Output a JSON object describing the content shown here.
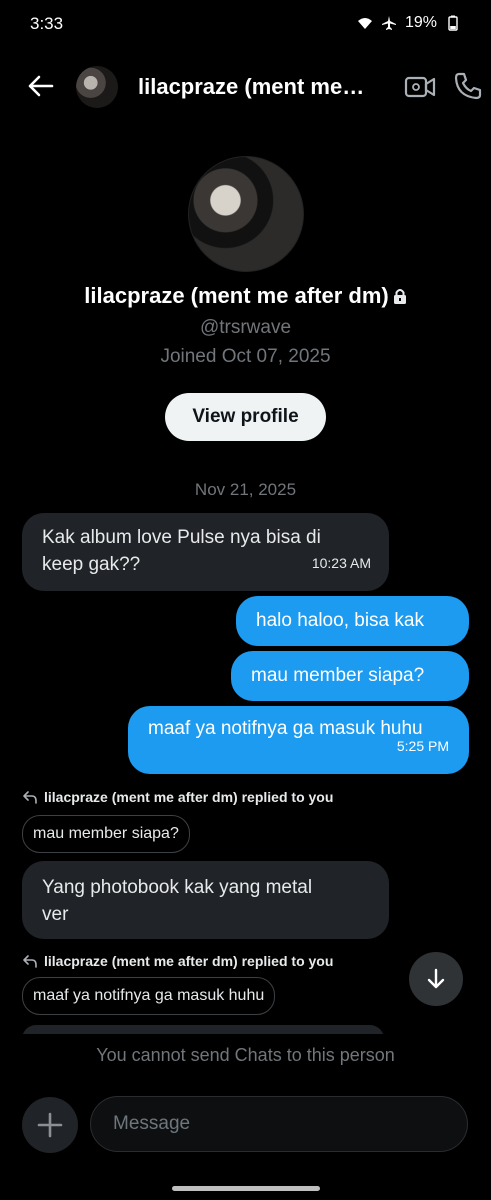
{
  "status_bar": {
    "time": "3:33",
    "battery": "19%"
  },
  "header": {
    "title": "lilacpraze (ment me…"
  },
  "profile": {
    "name": "lilacpraze (ment me after dm)",
    "handle": "@trsrwave",
    "joined": "Joined Oct 07, 2025",
    "view_profile_label": "View profile"
  },
  "conversation": {
    "date": "Nov 21, 2025",
    "msg1": {
      "text_line1": "Kak album love Pulse nya bisa di",
      "text_line2": "keep gak??",
      "time": "10:23 AM"
    },
    "msg2": {
      "text": "halo haloo, bisa kak"
    },
    "msg3": {
      "text": "mau member siapa?"
    },
    "msg4": {
      "text": "maaf ya notifnya ga masuk huhu",
      "time": "5:25 PM"
    },
    "reply1": {
      "label": "lilacpraze (ment me after dm) replied to you",
      "quote": "mau member siapa?"
    },
    "msg5": {
      "text_line1": "Yang photobook kak yang metal",
      "text_line2": "ver"
    },
    "reply2": {
      "label": "lilacpraze (ment me after dm) replied to you",
      "quote": "maaf ya notifnya ga masuk huhu"
    }
  },
  "footer": {
    "notice": "You cannot send Chats to this person",
    "message_placeholder": "Message"
  }
}
